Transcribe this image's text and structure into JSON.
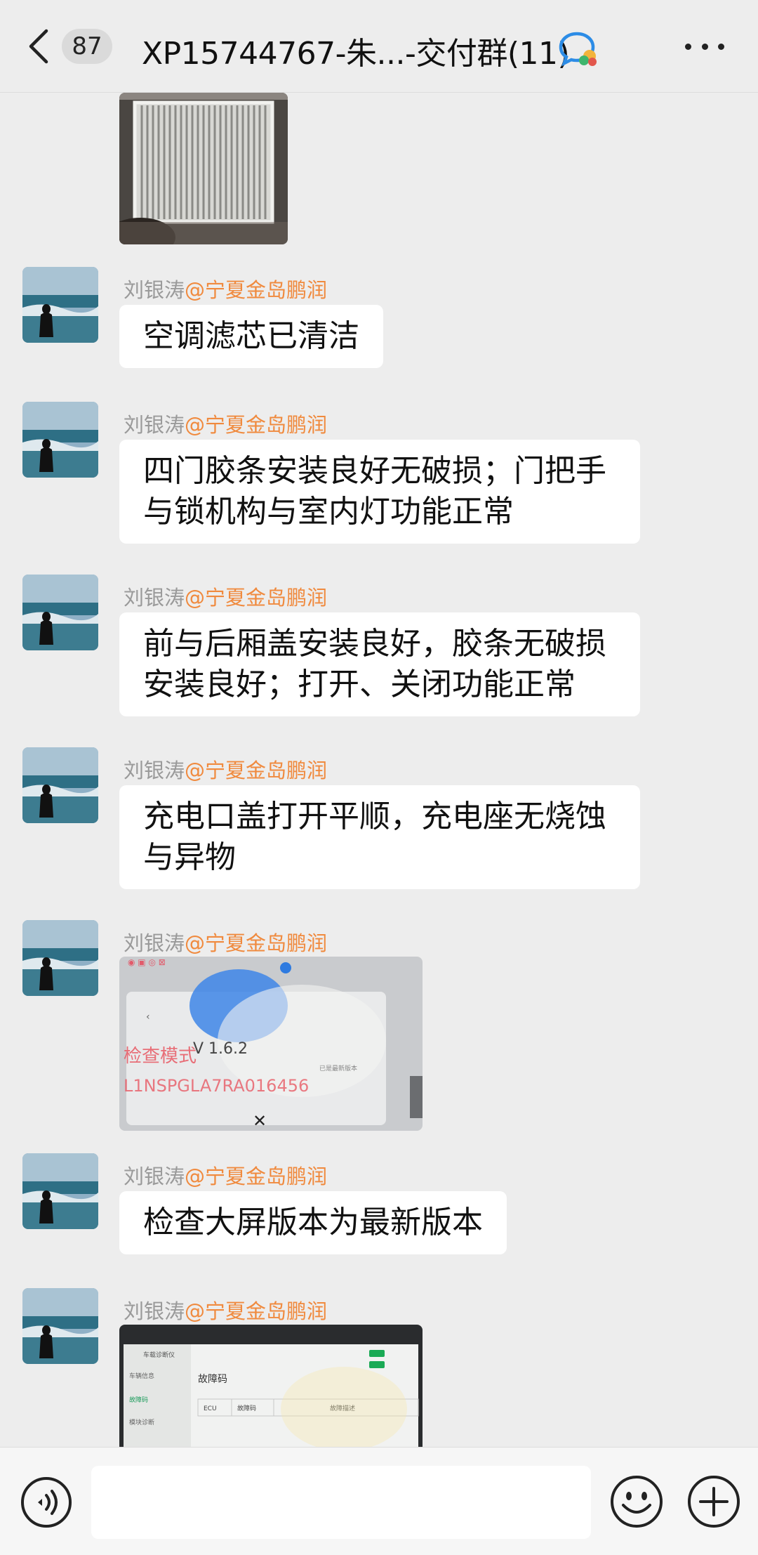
{
  "header": {
    "back_icon": "chevron-left-icon",
    "unread_count": "87",
    "title": "XP15744767-朱...-交付群(11)",
    "group_icon": "chat-group-icon",
    "more_icon": "more-horizontal-icon"
  },
  "messages": [
    {
      "sender": "刘银涛",
      "at": "@宁夏金岛鹏润",
      "text": "空调滤芯已清洁"
    },
    {
      "sender": "刘银涛",
      "at": "@宁夏金岛鹏润",
      "line1": "四门胶条安装良好无破损；门把手",
      "line2": "与锁机构与室内灯功能正常"
    },
    {
      "sender": "刘银涛",
      "at": "@宁夏金岛鹏润",
      "line1": "前与后厢盖安装良好，胶条无破损",
      "line2": "安装良好；打开、关闭功能正常"
    },
    {
      "sender": "刘银涛",
      "at": "@宁夏金岛鹏润",
      "line1": "充电口盖打开平顺，充电座无烧蚀",
      "line2": "与异物"
    },
    {
      "sender": "刘银涛",
      "at": "@宁夏金岛鹏润",
      "photo": {
        "version": "V 1.6.2",
        "mode": "检查模式",
        "vin": "L1NSPGLA7RA016456",
        "small": "已是最新版本"
      }
    },
    {
      "sender": "刘银涛",
      "at": "@宁夏金岛鹏润",
      "text": "检查大屏版本为最新版本"
    },
    {
      "sender": "刘银涛",
      "at": "@宁夏金岛鹏润",
      "photo": {
        "app": "车载诊断仪",
        "section": "故障码",
        "menu1": "车辆信息",
        "menu2": "故障码",
        "menu3": "模块诊断",
        "col1": "ECU",
        "col2": "故障码",
        "col3": "故障描述"
      }
    }
  ],
  "bottom": {
    "voice_icon": "voice-input-icon",
    "emoji_icon": "emoji-icon",
    "plus_icon": "plus-circle-icon"
  }
}
